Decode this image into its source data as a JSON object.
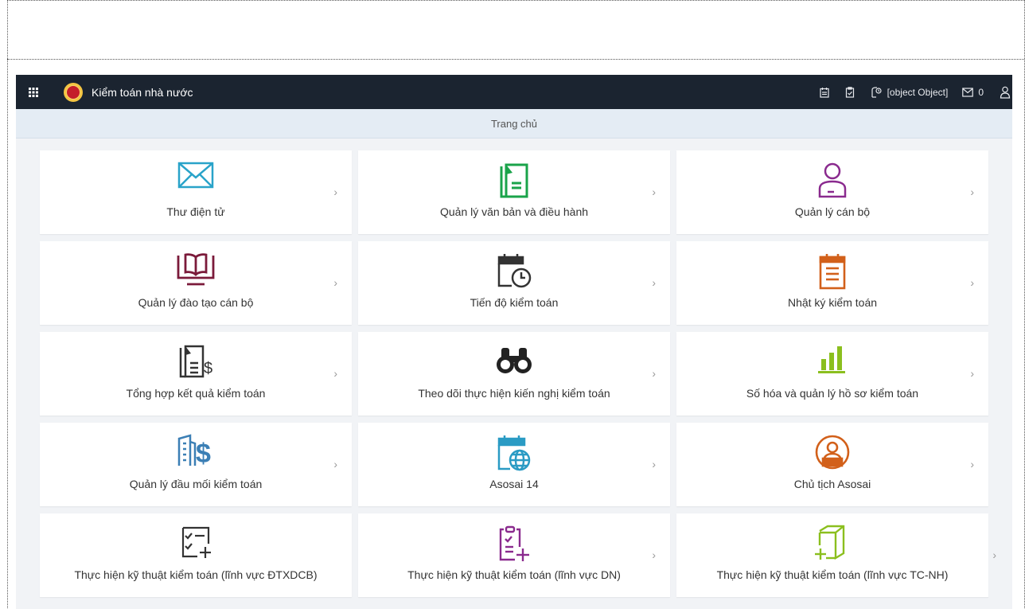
{
  "header": {
    "app_title": "Kiểm toán nhà nước",
    "user_label": "[object Object]",
    "mail_count": "0"
  },
  "breadcrumb": {
    "label": "Trang chủ"
  },
  "tiles": [
    {
      "label": "Thư điện tử",
      "icon": "envelope-icon",
      "color": "#29a3c9",
      "chevron": "›"
    },
    {
      "label": "Quản lý văn bản và điều hành",
      "icon": "document-icon",
      "color": "#1aa34a",
      "chevron": "›"
    },
    {
      "label": "Quản lý cán bộ",
      "icon": "person-icon",
      "color": "#8a2a8e",
      "chevron": "›"
    },
    {
      "label": "Quản lý đào tạo cán bộ",
      "icon": "book-monitor-icon",
      "color": "#7b1a3a",
      "chevron": "›"
    },
    {
      "label": "Tiến độ kiểm toán",
      "icon": "calendar-clock-icon",
      "color": "#333333",
      "chevron": "›"
    },
    {
      "label": "Nhật ký kiểm toán",
      "icon": "notepad-icon",
      "color": "#d2601a",
      "chevron": "›"
    },
    {
      "label": "Tổng hợp kết quả kiểm toán",
      "icon": "document-dollar-icon",
      "color": "#333333",
      "chevron": "›"
    },
    {
      "label": "Theo dõi thực hiện kiến nghị kiểm toán",
      "icon": "binoculars-icon",
      "color": "#222222",
      "chevron": "›"
    },
    {
      "label": "Số hóa và quản lý hồ sơ kiểm toán",
      "icon": "bar-chart-icon",
      "color": "#8bbf1e",
      "chevron": "›"
    },
    {
      "label": "Quản lý đầu mối kiểm toán",
      "icon": "building-dollar-icon",
      "color": "#3b7fb5",
      "chevron": "›"
    },
    {
      "label": "Asosai 14",
      "icon": "calendar-globe-icon",
      "color": "#2a9bc4",
      "chevron": "›"
    },
    {
      "label": "Chủ tịch Asosai",
      "icon": "chairman-icon",
      "color": "#d2601a",
      "chevron": "›"
    },
    {
      "label": "Thực hiện kỹ thuật kiểm toán (lĩnh vực ĐTXDCB)",
      "icon": "checklist-add-icon",
      "color": "#333333",
      "chevron": ""
    },
    {
      "label": "Thực hiện kỹ thuật kiểm toán (lĩnh vực DN)",
      "icon": "clipboard-add-icon",
      "color": "#8a2a8e",
      "chevron": "›"
    },
    {
      "label": "Thực hiện kỹ thuật kiểm toán (lĩnh vực TC-NH)",
      "icon": "pages-add-icon",
      "color": "#8bbf1e",
      "chevron": "›"
    }
  ]
}
